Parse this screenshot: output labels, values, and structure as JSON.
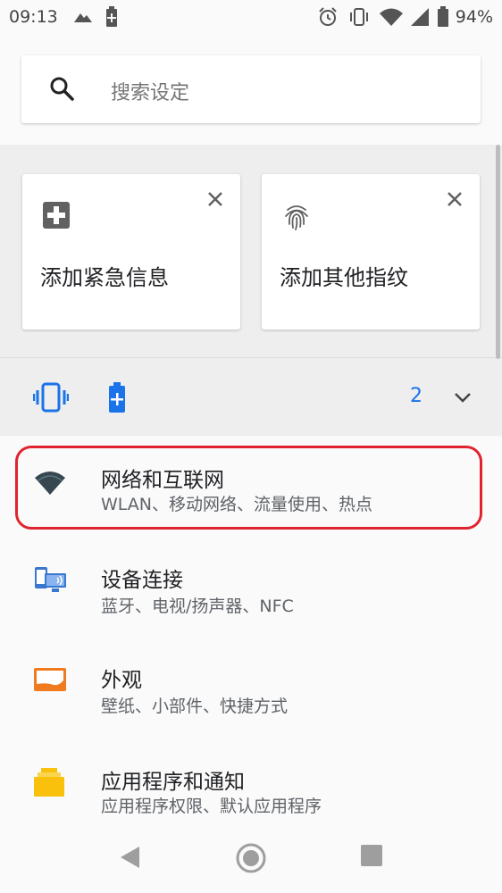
{
  "status_bar": {
    "time": "09:13",
    "battery": "94%",
    "icons": [
      "mountain-icon",
      "battery-plus-icon",
      "alarm-icon",
      "vibrate-icon",
      "wifi-icon",
      "signal-icon",
      "battery-icon"
    ]
  },
  "search": {
    "placeholder": "搜索设定",
    "icon": "search-icon"
  },
  "suggestions": {
    "cards": [
      {
        "label": "添加紧急信息",
        "icon": "medical-plus-icon"
      },
      {
        "label": "添加其他指纹",
        "icon": "fingerprint-icon"
      }
    ],
    "conditions": {
      "icons": [
        "vibrate-icon",
        "battery-saver-icon"
      ],
      "count": "2"
    }
  },
  "settings": [
    {
      "title": "网络和互联网",
      "subtitle": "WLAN、移动网络、流量使用、热点",
      "icon": "wifi-icon",
      "highlighted": true
    },
    {
      "title": "设备连接",
      "subtitle": "蓝牙、电视/扬声器、NFC",
      "icon": "devices-icon"
    },
    {
      "title": "外观",
      "subtitle": "壁纸、小部件、快捷方式",
      "icon": "display-icon"
    },
    {
      "title": "应用程序和通知",
      "subtitle": "应用程序权限、默认应用程序",
      "icon": "apps-icon"
    }
  ],
  "colors": {
    "accent": "#1a73e8",
    "highlight": "#e0242f",
    "display_orange": "#f07b1e",
    "apps_yellow": "#f9c10b",
    "devices_blue": "#3a77cf"
  }
}
